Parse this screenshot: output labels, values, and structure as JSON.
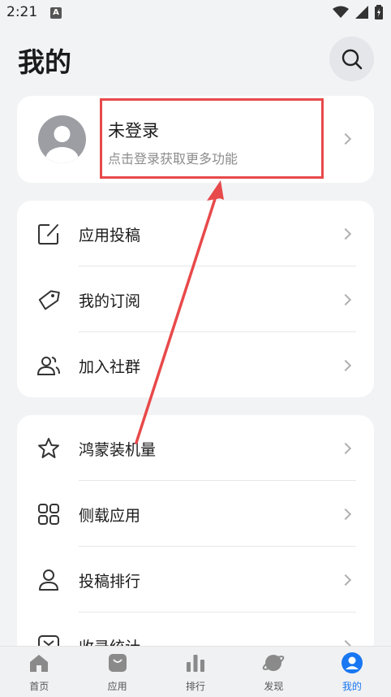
{
  "status_bar": {
    "time": "2:21",
    "notification_letter": "A"
  },
  "header": {
    "title": "我的"
  },
  "login_card": {
    "title": "未登录",
    "subtitle": "点击登录获取更多功能"
  },
  "group1": [
    {
      "label": "应用投稿",
      "icon": "edit-icon"
    },
    {
      "label": "我的订阅",
      "icon": "tag-icon"
    },
    {
      "label": "加入社群",
      "icon": "group-icon"
    }
  ],
  "group2": [
    {
      "label": "鸿蒙装机量",
      "icon": "star-icon"
    },
    {
      "label": "侧载应用",
      "icon": "grid-icon"
    },
    {
      "label": "投稿排行",
      "icon": "person-icon"
    },
    {
      "label": "收录统计",
      "icon": "inbox-icon"
    }
  ],
  "tabs": [
    {
      "label": "首页",
      "icon": "home-icon",
      "active": false
    },
    {
      "label": "应用",
      "icon": "bag-icon",
      "active": false
    },
    {
      "label": "排行",
      "icon": "bar-chart-icon",
      "active": false
    },
    {
      "label": "发现",
      "icon": "planet-icon",
      "active": false
    },
    {
      "label": "我的",
      "icon": "profile-icon",
      "active": true
    }
  ],
  "colors": {
    "accent": "#1877f2",
    "annotation": "#e8494a",
    "background": "#f2f3f5"
  }
}
